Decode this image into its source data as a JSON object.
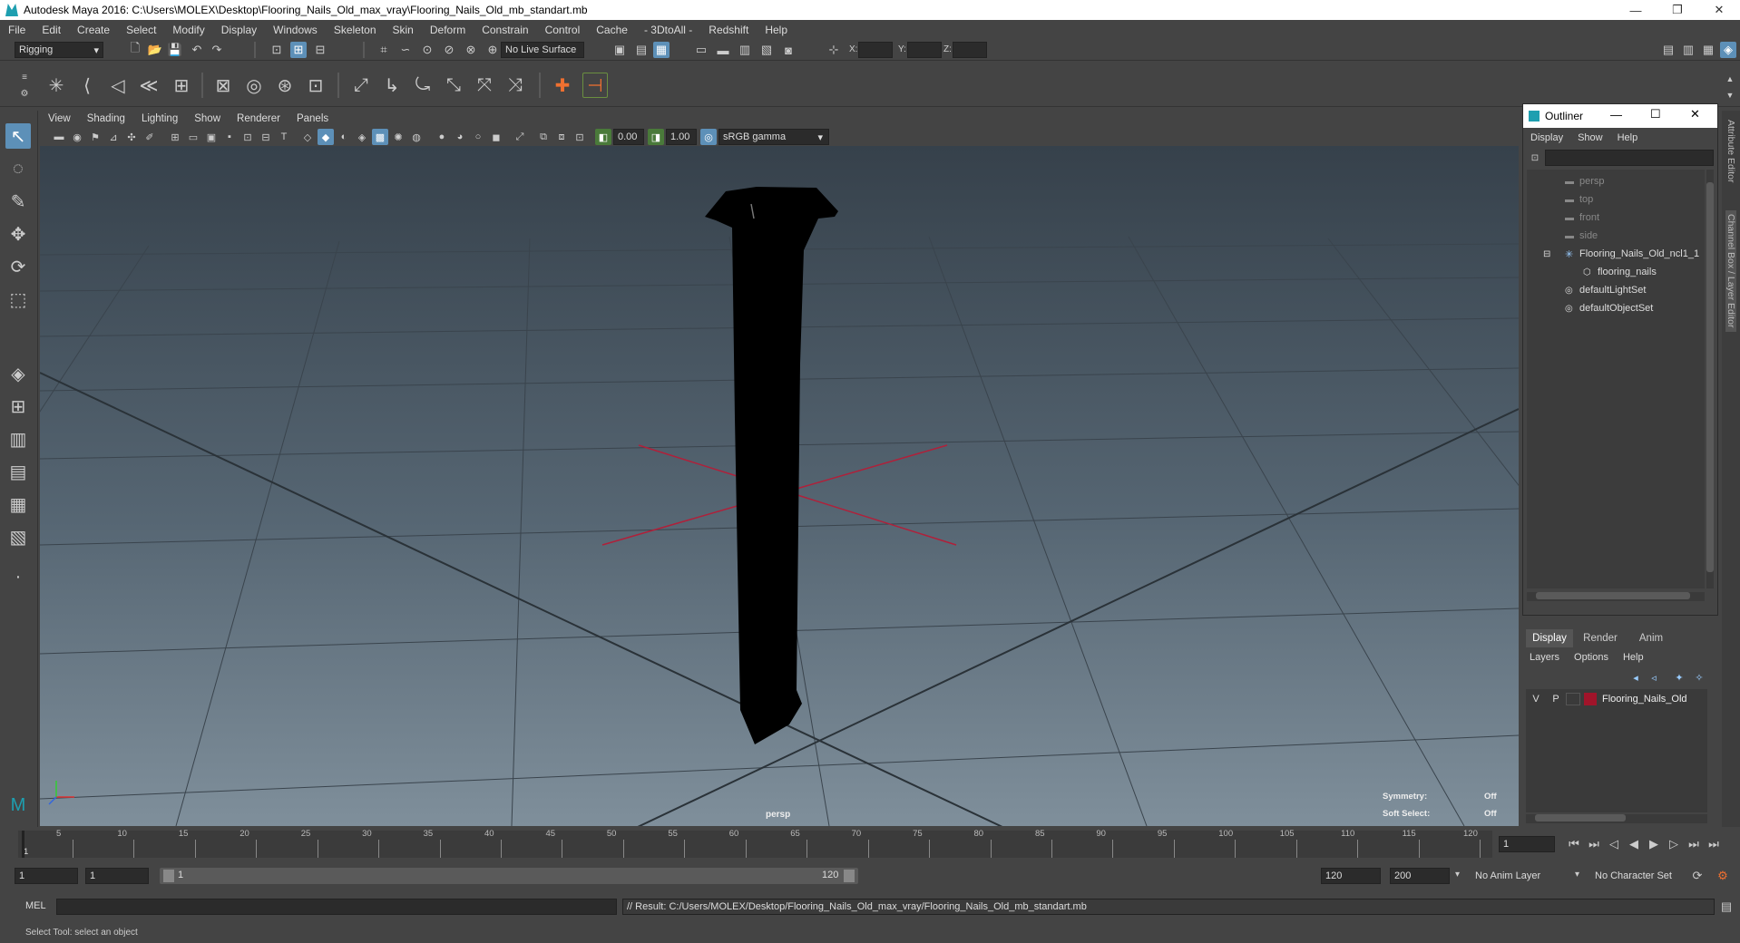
{
  "window": {
    "title": "Autodesk Maya 2016: C:\\Users\\MOLEX\\Desktop\\Flooring_Nails_Old_max_vray\\Flooring_Nails_Old_mb_standart.mb",
    "minimize": "—",
    "restore": "❐",
    "close": "✕"
  },
  "menubar": [
    "File",
    "Edit",
    "Create",
    "Select",
    "Modify",
    "Display",
    "Windows",
    "Skeleton",
    "Skin",
    "Deform",
    "Constrain",
    "Control",
    "Cache",
    "- 3DtoAll -",
    "Redshift",
    "Help"
  ],
  "status_line": {
    "mode": "Rigging",
    "live_surface": "No Live Surface",
    "x_label": "X:",
    "y_label": "Y:",
    "z_label": "Z:"
  },
  "panel_menu": [
    "View",
    "Shading",
    "Lighting",
    "Show",
    "Renderer",
    "Panels"
  ],
  "panel_toolbar": {
    "exposure": "0.00",
    "gamma": "1.00",
    "color_space": "sRGB gamma"
  },
  "viewport": {
    "camera_label": "persp",
    "symmetry_label": "Symmetry:",
    "symmetry_value": "Off",
    "soft_select_label": "Soft Select:",
    "soft_select_value": "Off"
  },
  "outliner": {
    "title": "Outliner",
    "menu": [
      "Display",
      "Show",
      "Help"
    ],
    "items": [
      {
        "label": "persp",
        "icon": "camera-icon"
      },
      {
        "label": "top",
        "icon": "camera-icon"
      },
      {
        "label": "front",
        "icon": "camera-icon"
      },
      {
        "label": "side",
        "icon": "camera-icon"
      },
      {
        "label": "Flooring_Nails_Old_ncl1_1",
        "icon": "group-icon"
      },
      {
        "label": "flooring_nails",
        "icon": "mesh-icon"
      },
      {
        "label": "defaultLightSet",
        "icon": "set-icon"
      },
      {
        "label": "defaultObjectSet",
        "icon": "set-icon"
      }
    ]
  },
  "layer_editor": {
    "tabs": [
      "Display",
      "Render",
      "Anim"
    ],
    "menu": [
      "Layers",
      "Options",
      "Help"
    ],
    "layer": {
      "v": "V",
      "p": "P",
      "name": "Flooring_Nails_Old",
      "color": "#a0142a"
    }
  },
  "side_tabs": [
    "Attribute Editor",
    "Channel Box / Layer Editor"
  ],
  "timeline": {
    "ticks": [
      "5",
      "10",
      "15",
      "20",
      "25",
      "30",
      "35",
      "40",
      "45",
      "50",
      "55",
      "60",
      "65",
      "70",
      "75",
      "80",
      "85",
      "90",
      "95",
      "100",
      "105",
      "110",
      "115",
      "120"
    ],
    "first_tick": "1",
    "current_frame": "1"
  },
  "range": {
    "start": "1",
    "playback_start": "1",
    "slider_start": "1",
    "slider_end": "120",
    "playback_end": "120",
    "end": "200",
    "anim_layer": "No Anim Layer",
    "character_set": "No Character Set"
  },
  "command_line": {
    "lang": "MEL",
    "result": "// Result: C:/Users/MOLEX/Desktop/Flooring_Nails_Old_max_vray/Flooring_Nails_Old_mb_standart.mb"
  },
  "help_line": "Select Tool: select an object",
  "colors": {
    "accent": "#5d90b8",
    "layer": "#a0142a",
    "origin_axis": "#b0203a"
  }
}
